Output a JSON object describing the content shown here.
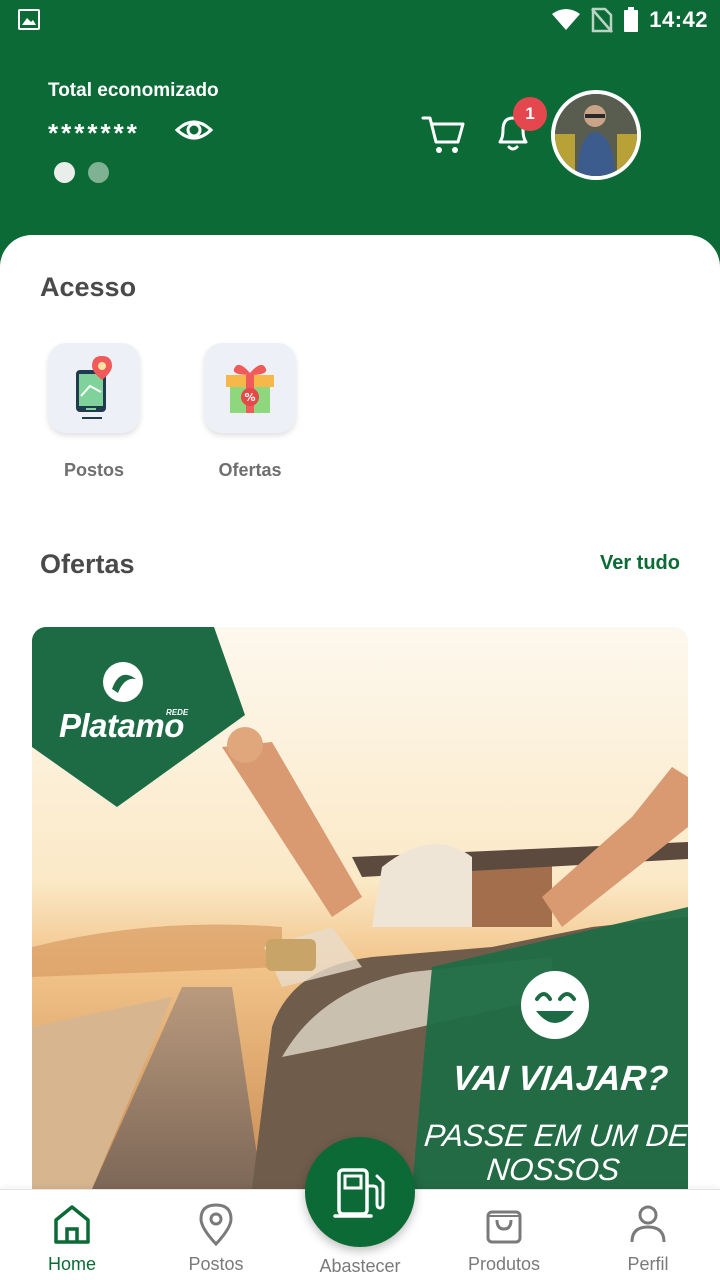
{
  "status_bar": {
    "time": "14:42",
    "left_icon": "image-icon",
    "right_icons": [
      "wifi-icon",
      "no-sim-icon",
      "battery-icon"
    ]
  },
  "header": {
    "total_label": "Total economizado",
    "total_value_masked": "*******",
    "eye_icon": "eye-icon",
    "cart_icon": "cart-icon",
    "bell_icon": "bell-icon",
    "notification_count": "1",
    "carousel_dots": 2,
    "carousel_active_index": 0
  },
  "acesso": {
    "title": "Acesso",
    "items": [
      {
        "label": "Postos",
        "icon": "map-phone-icon"
      },
      {
        "label": "Ofertas",
        "icon": "gift-discount-icon"
      }
    ]
  },
  "ofertas": {
    "title": "Ofertas",
    "see_all": "Ver tudo",
    "banner": {
      "brand": "Platamo",
      "brand_small": "REDE",
      "headline": "VAI VIAJAR?",
      "subline": "PASSE EM UM DE NOSSOS"
    }
  },
  "bottom_nav": {
    "items": [
      {
        "label": "Home",
        "icon": "home-icon",
        "active": true
      },
      {
        "label": "Postos",
        "icon": "location-pin-icon",
        "active": false
      },
      {
        "label": "Abastecer",
        "icon": "fuel-pump-icon",
        "active": false
      },
      {
        "label": "Produtos",
        "icon": "shopping-bag-icon",
        "active": false
      },
      {
        "label": "Perfil",
        "icon": "person-icon",
        "active": false
      }
    ]
  },
  "colors": {
    "brand_green": "#0b6a35",
    "badge_red": "#e5474e",
    "text_dark": "#4a4a4a",
    "text_muted": "#7a7a7a"
  }
}
